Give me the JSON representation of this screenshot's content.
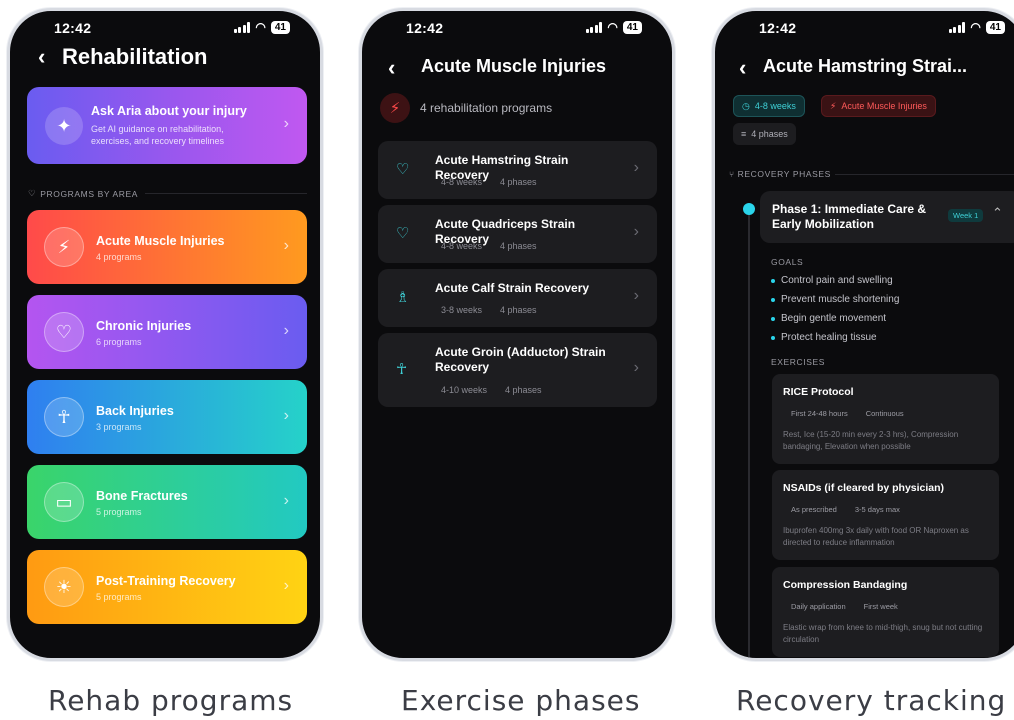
{
  "status": {
    "time": "12:42",
    "battery": "41"
  },
  "screen1": {
    "title": "Rehabilitation",
    "aria": {
      "title": "Ask Aria about your injury",
      "subtitle": "Get AI guidance on rehabilitation, exercises, and recovery timelines",
      "icon": "sparkle-icon"
    },
    "section_label": "PROGRAMS BY AREA",
    "areas": [
      {
        "name": "Acute Muscle Injuries",
        "count": "4 programs",
        "icon": "lightning-icon",
        "colors": [
          "#ff4a4a",
          "#ff9a1f"
        ]
      },
      {
        "name": "Chronic Injuries",
        "count": "6 programs",
        "icon": "heart-pulse-icon",
        "colors": [
          "#b455f0",
          "#6a5cf0"
        ]
      },
      {
        "name": "Back Injuries",
        "count": "3 programs",
        "icon": "person-icon",
        "colors": [
          "#2f7ff0",
          "#25d2c9"
        ]
      },
      {
        "name": "Bone Fractures",
        "count": "5 programs",
        "icon": "bandage-icon",
        "colors": [
          "#3ad46a",
          "#22c9c2"
        ]
      },
      {
        "name": "Post-Training Recovery",
        "count": "5 programs",
        "icon": "sun-icon",
        "colors": [
          "#ff9a12",
          "#ffd313"
        ]
      }
    ]
  },
  "screen2": {
    "title": "Acute Muscle Injuries",
    "subtitle": "4 rehabilitation programs",
    "programs": [
      {
        "title": "Acute Hamstring Strain Recovery",
        "weeks": "4-8 weeks",
        "phases": "4 phases",
        "icon": "heart-pulse-icon"
      },
      {
        "title": "Acute Quadriceps Strain Recovery",
        "weeks": "4-8 weeks",
        "phases": "4 phases",
        "icon": "heart-pulse-icon"
      },
      {
        "title": "Acute Calf Strain Recovery",
        "weeks": "3-8 weeks",
        "phases": "4 phases",
        "icon": "walking-icon"
      },
      {
        "title": "Acute Groin (Adductor) Strain Recovery",
        "weeks": "4-10 weeks",
        "phases": "4 phases",
        "icon": "person-icon"
      }
    ]
  },
  "screen3": {
    "title": "Acute Hamstring Strai...",
    "chips": {
      "weeks": "4-8 weeks",
      "category": "Acute Muscle Injuries",
      "phases": "4 phases"
    },
    "recovery_label": "RECOVERY PHASES",
    "phase": {
      "title": "Phase 1: Immediate Care & Early Mobilization",
      "badge": "Week 1"
    },
    "goals_label": "GOALS",
    "goals": [
      "Control pain and swelling",
      "Prevent muscle shortening",
      "Begin gentle movement",
      "Protect healing tissue"
    ],
    "exercises_label": "EXERCISES",
    "exercises": [
      {
        "title": "RICE Protocol",
        "frequency": "First 24-48 hours",
        "duration": "Continuous",
        "description": "Rest, Ice (15-20 min every 2-3 hrs), Compression bandaging, Elevation when possible"
      },
      {
        "title": "NSAIDs (if cleared by physician)",
        "frequency": "As prescribed",
        "duration": "3-5 days max",
        "description": "Ibuprofen 400mg 3x daily with food OR Naproxen as directed to reduce inflammation"
      },
      {
        "title": "Compression Bandaging",
        "frequency": "Daily application",
        "duration": "First week",
        "description": "Elastic wrap from knee to mid-thigh, snug but not cutting circulation"
      }
    ]
  },
  "captions": [
    "Rehab programs",
    "Exercise phases",
    "Recovery tracking"
  ]
}
